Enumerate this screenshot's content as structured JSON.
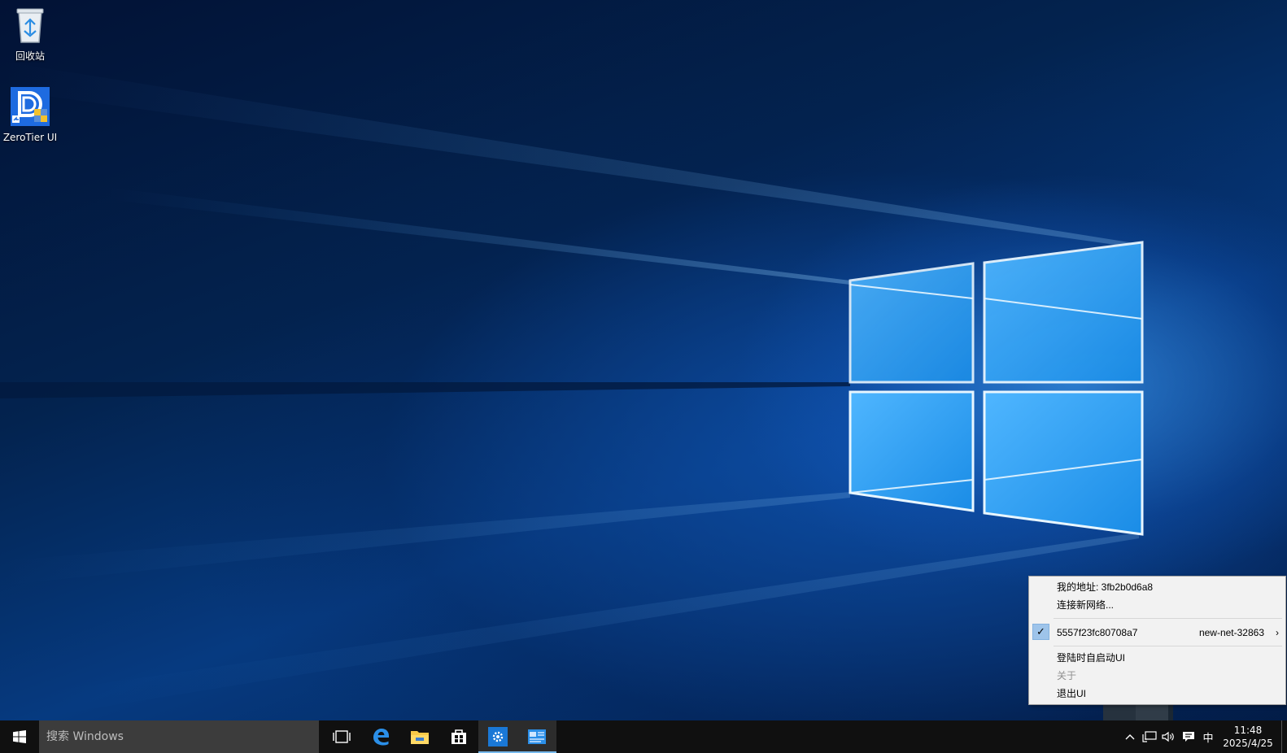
{
  "desktop": {
    "icons": [
      {
        "label": "回收站",
        "icon": "recycle-bin-icon"
      },
      {
        "label": "ZeroTier UI",
        "icon": "zerotier-ui-icon"
      }
    ]
  },
  "context_menu": {
    "my_address": "我的地址:  3fb2b0d6a8",
    "join_network": "连接新网络...",
    "network": {
      "id": "5557f23fc80708a7",
      "name": "new-net-32863",
      "checked": true
    },
    "autostart": "登陆时自启动UI",
    "about": "关于",
    "exit": "退出UI"
  },
  "taskbar": {
    "search_placeholder": "搜索 Windows",
    "pinned": [
      "task-view-icon",
      "edge-icon",
      "file-explorer-icon",
      "store-icon",
      "settings-icon",
      "zerotier-ui-icon"
    ],
    "active_color": "#76b9ed",
    "ime": "中",
    "time": "11:48",
    "date": "2025/4/25"
  }
}
